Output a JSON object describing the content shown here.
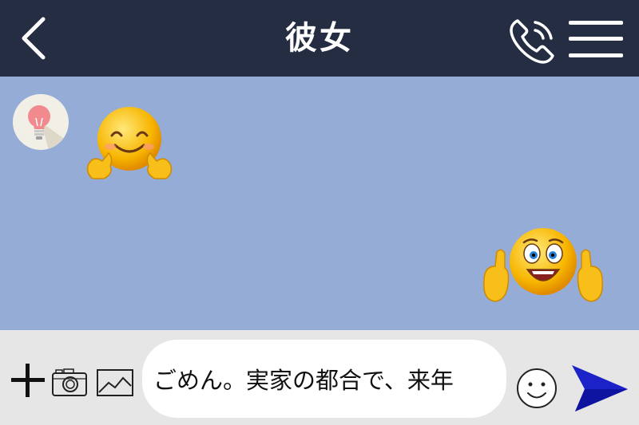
{
  "header": {
    "title": "彼女",
    "back_icon": "chevron-left-icon",
    "call_icon": "phone-icon",
    "menu_icon": "hamburger-menu-icon"
  },
  "chat": {
    "background_color": "#95acd6",
    "messages": [
      {
        "sender": "partner",
        "type": "sticker",
        "sticker": "smiling-hugging-emoji"
      },
      {
        "sender": "self",
        "type": "sticker",
        "sticker": "thumbs-up-laughing-emoji"
      }
    ],
    "partner_avatar": "lightbulb-icon"
  },
  "input_bar": {
    "plus_icon": "plus-icon",
    "camera_icon": "camera-icon",
    "image_icon": "image-icon",
    "message_text": "ごめん。実家の都合で、来年",
    "emoji_icon": "smiley-face-icon",
    "send_icon": "send-icon",
    "send_color": "#1b22c8"
  },
  "colors": {
    "header_bg": "#252d42",
    "input_bar_bg": "#e6e6e6"
  }
}
